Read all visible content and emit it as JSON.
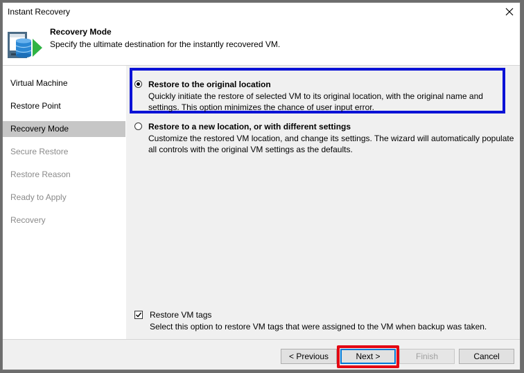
{
  "window": {
    "title": "Instant Recovery"
  },
  "header": {
    "title": "Recovery Mode",
    "subtitle": "Specify the ultimate destination for the instantly recovered VM."
  },
  "sidebar": {
    "items": [
      {
        "label": "Virtual Machine",
        "state": "enabled"
      },
      {
        "label": "Restore Point",
        "state": "enabled"
      },
      {
        "label": "Recovery Mode",
        "state": "active"
      },
      {
        "label": "Secure Restore",
        "state": "disabled"
      },
      {
        "label": "Restore Reason",
        "state": "disabled"
      },
      {
        "label": "Ready to Apply",
        "state": "disabled"
      },
      {
        "label": "Recovery",
        "state": "disabled"
      }
    ]
  },
  "options": {
    "original": {
      "label": "Restore to the original location",
      "description": "Quickly initiate the restore of selected VM to its original location, with the original name and settings. This option minimizes the chance of user input error.",
      "selected": true
    },
    "new_location": {
      "label": "Restore to a new location, or with different settings",
      "description": "Customize the restored VM location, and change its settings. The wizard will automatically populate all controls with the original VM settings as the defaults.",
      "selected": false
    }
  },
  "tags": {
    "label": "Restore VM tags",
    "description": "Select this option to restore VM tags that were assigned to the VM when backup was taken.",
    "checked": true
  },
  "footer": {
    "previous_label": "< Previous",
    "next_label": "Next >",
    "finish_label": "Finish",
    "cancel_label": "Cancel"
  },
  "colors": {
    "highlight_blue": "#0b12d6",
    "highlight_red": "#e30613",
    "active_nav": "#c6c6c6",
    "logo_green": "#2fb344"
  }
}
